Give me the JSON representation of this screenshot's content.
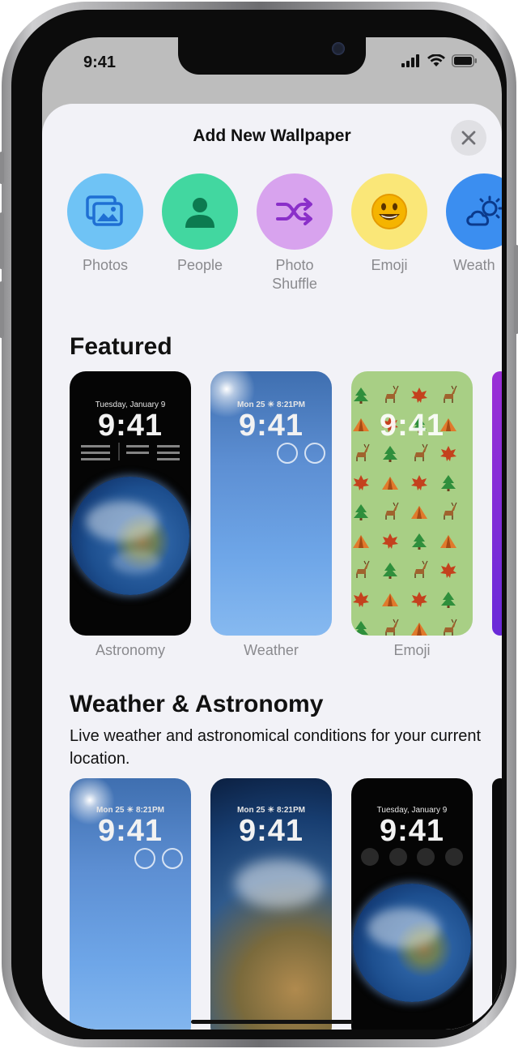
{
  "status": {
    "time": "9:41"
  },
  "sheet": {
    "title": "Add New Wallpaper"
  },
  "categories": [
    {
      "label": "Photos",
      "icon": "photos-icon",
      "color": "#6fc3f5"
    },
    {
      "label": "People",
      "icon": "person-icon",
      "color": "#42d7a0"
    },
    {
      "label": "Photo\nShuffle",
      "icon": "shuffle-icon",
      "color": "#d8a3ee"
    },
    {
      "label": "Emoji",
      "icon": "smiley-icon",
      "color": "#fae778"
    },
    {
      "label": "Weath",
      "icon": "weather-icon",
      "color": "#3b8ef0"
    }
  ],
  "featured": {
    "title": "Featured",
    "cards": [
      {
        "label": "Astronomy",
        "date": "Tuesday, January 9",
        "time": "9:41"
      },
      {
        "label": "Weather",
        "date": "Mon 25  ☀ 8:21PM",
        "time": "9:41"
      },
      {
        "label": "Emoji",
        "time": "9:41"
      }
    ]
  },
  "weather_astronomy": {
    "title": "Weather & Astronomy",
    "description": "Live weather and astronomical conditions for your current location.",
    "cards": [
      {
        "date": "Mon 25  ☀ 8:21PM",
        "time": "9:41"
      },
      {
        "date": "Mon 25  ☀ 8:21PM",
        "time": "9:41"
      },
      {
        "date": "Tuesday, January 9",
        "time": "9:41"
      }
    ]
  }
}
